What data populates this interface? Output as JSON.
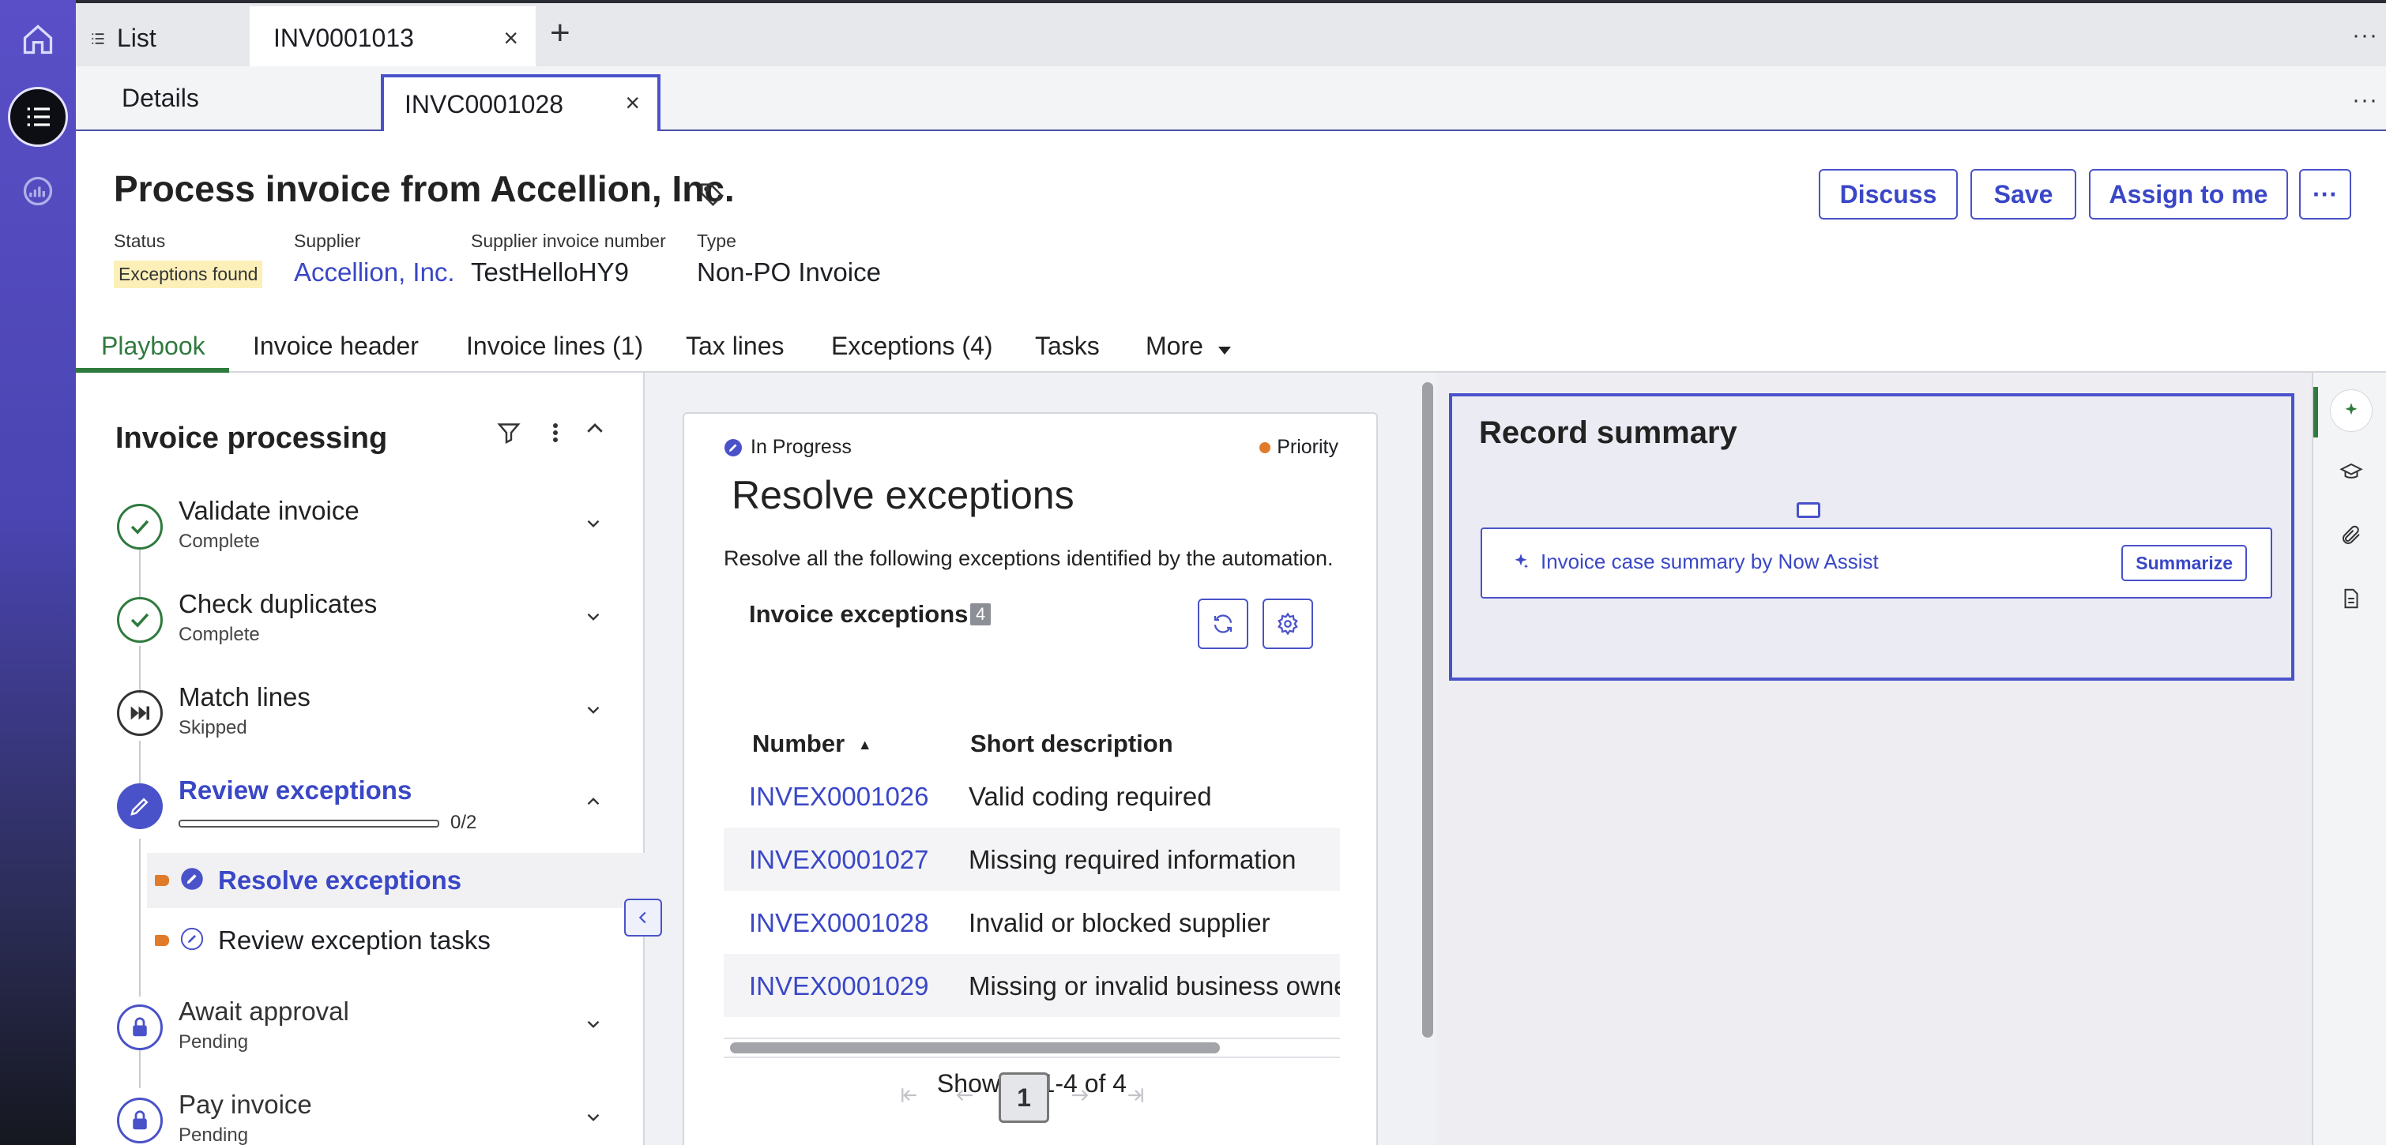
{
  "top_tabs": {
    "list_label": "List",
    "record_tab": "INV0001013",
    "close_glyph": "×",
    "add_glyph": "+",
    "more_glyph": "···"
  },
  "sub_tabs": {
    "details": "Details",
    "case_tab": "INVC0001028",
    "close_glyph": "×",
    "more_glyph": "···"
  },
  "header": {
    "title": "Process invoice from Accellion, Inc.",
    "fields": [
      {
        "label": "Status",
        "value": "Exceptions found"
      },
      {
        "label": "Supplier",
        "value": "Accellion, Inc."
      },
      {
        "label": "Supplier invoice number",
        "value": "TestHelloHY9"
      },
      {
        "label": "Type",
        "value": "Non-PO Invoice"
      }
    ],
    "buttons": {
      "discuss": "Discuss",
      "save": "Save",
      "assign": "Assign to me",
      "more": "···"
    },
    "status_badge_color": "#fcf0b8"
  },
  "nav_tabs": [
    "Playbook",
    "Invoice header",
    "Invoice lines (1)",
    "Tax lines",
    "Exceptions (4)",
    "Tasks",
    "More"
  ],
  "playbook": {
    "title": "Invoice processing",
    "steps": [
      {
        "name": "Validate invoice",
        "status": "Complete"
      },
      {
        "name": "Check duplicates",
        "status": "Complete"
      },
      {
        "name": "Match lines",
        "status": "Skipped"
      },
      {
        "name": "Review exceptions",
        "status": "",
        "progress_text": "0/2",
        "progress": 0
      },
      {
        "name": "Await approval",
        "status": "Pending"
      },
      {
        "name": "Pay invoice",
        "status": "Pending"
      }
    ],
    "subtasks": [
      "Resolve exceptions",
      "Review exception tasks"
    ]
  },
  "activity": {
    "state": "In Progress",
    "priority": "Priority",
    "title": "Resolve exceptions",
    "description": "Resolve all the following exceptions identified by the automation.",
    "list_title": "Invoice exceptions",
    "count": "4",
    "columns": {
      "number": "Number",
      "short_description": "Short description",
      "sort_glyph": "▲"
    },
    "rows": [
      {
        "number": "INVEX0001026",
        "desc": "Valid coding required"
      },
      {
        "number": "INVEX0001027",
        "desc": "Missing required information"
      },
      {
        "number": "INVEX0001028",
        "desc": "Invalid or blocked supplier"
      },
      {
        "number": "INVEX0001029",
        "desc": "Missing or invalid business owner"
      }
    ],
    "showing": "Showing 1-4 of 4",
    "page": "1"
  },
  "record_summary": {
    "title": "Record summary",
    "assist_text": "Invoice case summary by Now Assist",
    "summarize": "Summarize"
  },
  "colors": {
    "accent": "#4a52c9",
    "link": "#3a47c6",
    "active_tab": "#2f7a3e",
    "priority_dot": "#e07b2a"
  }
}
